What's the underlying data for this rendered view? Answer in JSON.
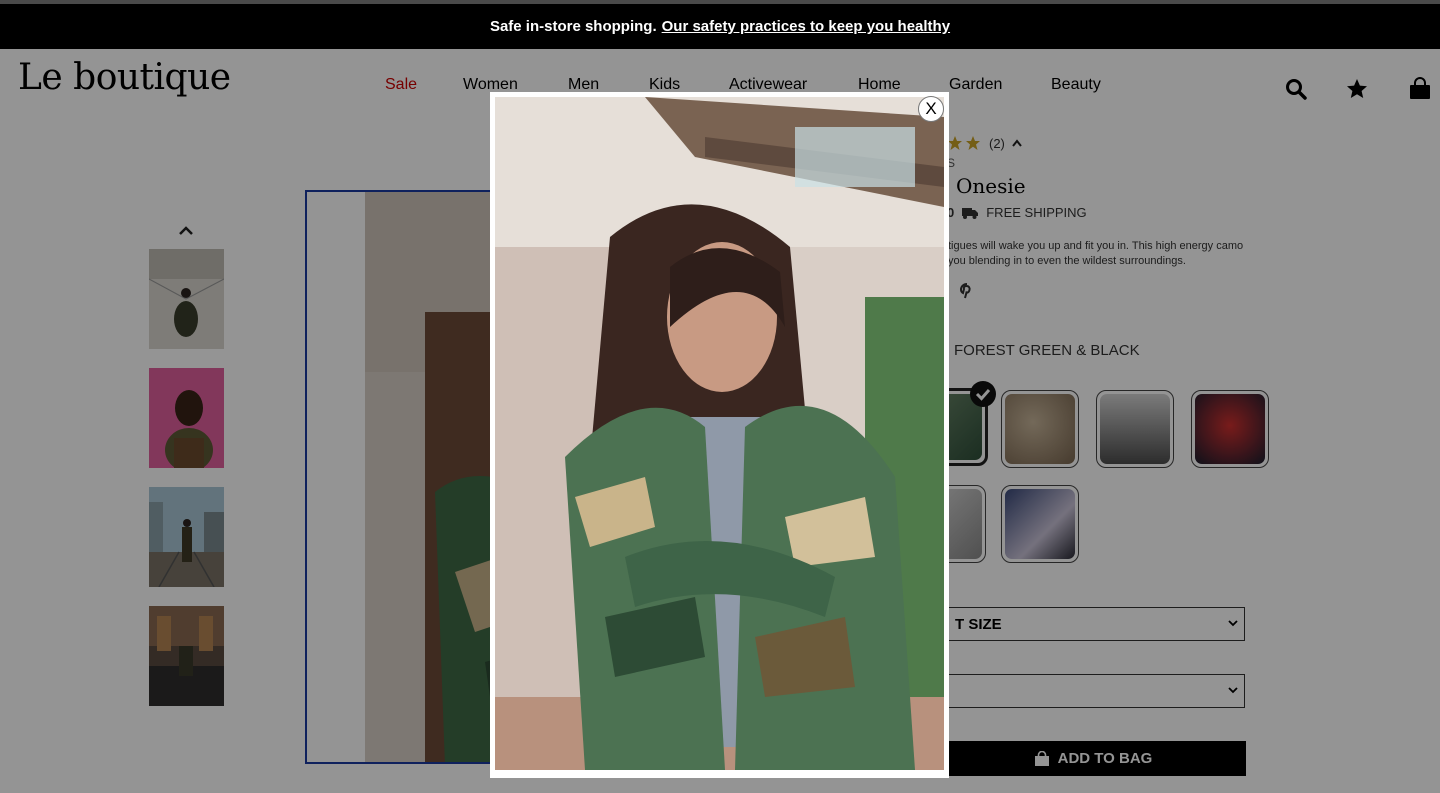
{
  "banner": {
    "bold": "Safe in-store shopping.",
    "link": "Our safety practices to keep you healthy"
  },
  "brand": {
    "logo": "Le boutique"
  },
  "nav": {
    "items": [
      "Sale",
      "Women",
      "Men",
      "Kids",
      "Activewear",
      "Home",
      "Garden",
      "Beauty"
    ]
  },
  "header_icons": [
    "search-icon",
    "star-icon",
    "shopping-bag-icon"
  ],
  "product": {
    "review_count": "(2)",
    "brand_fragment": "S",
    "title_fragment": "Onesie",
    "price_fragment": "0",
    "shipping": "FREE SHIPPING",
    "description": "tigues will wake you up and fit you in. This high energy camo you blending in to even the wildest surroundings.",
    "color_label": "FOREST GREEN & BLACK",
    "size_placeholder": "T SIZE",
    "add_to_bag": "ADD TO BAG"
  },
  "modal": {
    "close_label": "X"
  },
  "colors": {
    "sale": "#cc0000",
    "banner_bg": "#000000",
    "frame_border": "#1a3aa0",
    "star": "#c9a227"
  }
}
